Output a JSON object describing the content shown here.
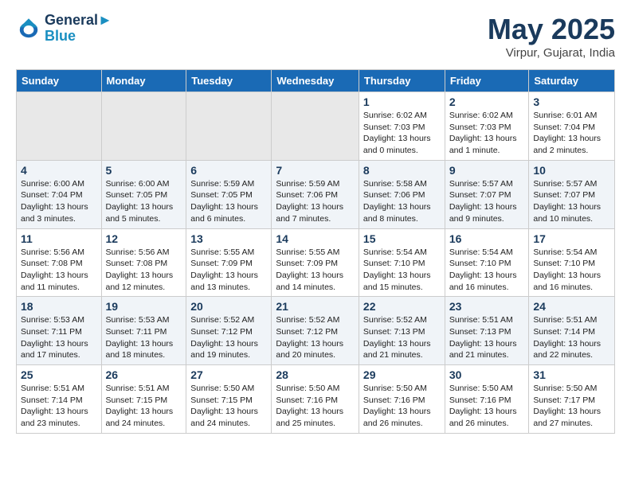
{
  "header": {
    "logo_line1": "General",
    "logo_line2": "Blue",
    "month": "May 2025",
    "location": "Virpur, Gujarat, India"
  },
  "days_of_week": [
    "Sunday",
    "Monday",
    "Tuesday",
    "Wednesday",
    "Thursday",
    "Friday",
    "Saturday"
  ],
  "weeks": [
    [
      {
        "day": "",
        "empty": true
      },
      {
        "day": "",
        "empty": true
      },
      {
        "day": "",
        "empty": true
      },
      {
        "day": "",
        "empty": true
      },
      {
        "day": "1",
        "sunrise": "6:02 AM",
        "sunset": "7:03 PM",
        "daylight": "13 hours and 0 minutes."
      },
      {
        "day": "2",
        "sunrise": "6:02 AM",
        "sunset": "7:03 PM",
        "daylight": "13 hours and 1 minute."
      },
      {
        "day": "3",
        "sunrise": "6:01 AM",
        "sunset": "7:04 PM",
        "daylight": "13 hours and 2 minutes."
      }
    ],
    [
      {
        "day": "4",
        "sunrise": "6:00 AM",
        "sunset": "7:04 PM",
        "daylight": "13 hours and 3 minutes."
      },
      {
        "day": "5",
        "sunrise": "6:00 AM",
        "sunset": "7:05 PM",
        "daylight": "13 hours and 5 minutes."
      },
      {
        "day": "6",
        "sunrise": "5:59 AM",
        "sunset": "7:05 PM",
        "daylight": "13 hours and 6 minutes."
      },
      {
        "day": "7",
        "sunrise": "5:59 AM",
        "sunset": "7:06 PM",
        "daylight": "13 hours and 7 minutes."
      },
      {
        "day": "8",
        "sunrise": "5:58 AM",
        "sunset": "7:06 PM",
        "daylight": "13 hours and 8 minutes."
      },
      {
        "day": "9",
        "sunrise": "5:57 AM",
        "sunset": "7:07 PM",
        "daylight": "13 hours and 9 minutes."
      },
      {
        "day": "10",
        "sunrise": "5:57 AM",
        "sunset": "7:07 PM",
        "daylight": "13 hours and 10 minutes."
      }
    ],
    [
      {
        "day": "11",
        "sunrise": "5:56 AM",
        "sunset": "7:08 PM",
        "daylight": "13 hours and 11 minutes."
      },
      {
        "day": "12",
        "sunrise": "5:56 AM",
        "sunset": "7:08 PM",
        "daylight": "13 hours and 12 minutes."
      },
      {
        "day": "13",
        "sunrise": "5:55 AM",
        "sunset": "7:09 PM",
        "daylight": "13 hours and 13 minutes."
      },
      {
        "day": "14",
        "sunrise": "5:55 AM",
        "sunset": "7:09 PM",
        "daylight": "13 hours and 14 minutes."
      },
      {
        "day": "15",
        "sunrise": "5:54 AM",
        "sunset": "7:10 PM",
        "daylight": "13 hours and 15 minutes."
      },
      {
        "day": "16",
        "sunrise": "5:54 AM",
        "sunset": "7:10 PM",
        "daylight": "13 hours and 16 minutes."
      },
      {
        "day": "17",
        "sunrise": "5:54 AM",
        "sunset": "7:10 PM",
        "daylight": "13 hours and 16 minutes."
      }
    ],
    [
      {
        "day": "18",
        "sunrise": "5:53 AM",
        "sunset": "7:11 PM",
        "daylight": "13 hours and 17 minutes."
      },
      {
        "day": "19",
        "sunrise": "5:53 AM",
        "sunset": "7:11 PM",
        "daylight": "13 hours and 18 minutes."
      },
      {
        "day": "20",
        "sunrise": "5:52 AM",
        "sunset": "7:12 PM",
        "daylight": "13 hours and 19 minutes."
      },
      {
        "day": "21",
        "sunrise": "5:52 AM",
        "sunset": "7:12 PM",
        "daylight": "13 hours and 20 minutes."
      },
      {
        "day": "22",
        "sunrise": "5:52 AM",
        "sunset": "7:13 PM",
        "daylight": "13 hours and 21 minutes."
      },
      {
        "day": "23",
        "sunrise": "5:51 AM",
        "sunset": "7:13 PM",
        "daylight": "13 hours and 21 minutes."
      },
      {
        "day": "24",
        "sunrise": "5:51 AM",
        "sunset": "7:14 PM",
        "daylight": "13 hours and 22 minutes."
      }
    ],
    [
      {
        "day": "25",
        "sunrise": "5:51 AM",
        "sunset": "7:14 PM",
        "daylight": "13 hours and 23 minutes."
      },
      {
        "day": "26",
        "sunrise": "5:51 AM",
        "sunset": "7:15 PM",
        "daylight": "13 hours and 24 minutes."
      },
      {
        "day": "27",
        "sunrise": "5:50 AM",
        "sunset": "7:15 PM",
        "daylight": "13 hours and 24 minutes."
      },
      {
        "day": "28",
        "sunrise": "5:50 AM",
        "sunset": "7:16 PM",
        "daylight": "13 hours and 25 minutes."
      },
      {
        "day": "29",
        "sunrise": "5:50 AM",
        "sunset": "7:16 PM",
        "daylight": "13 hours and 26 minutes."
      },
      {
        "day": "30",
        "sunrise": "5:50 AM",
        "sunset": "7:16 PM",
        "daylight": "13 hours and 26 minutes."
      },
      {
        "day": "31",
        "sunrise": "5:50 AM",
        "sunset": "7:17 PM",
        "daylight": "13 hours and 27 minutes."
      }
    ]
  ],
  "labels": {
    "sunrise": "Sunrise:",
    "sunset": "Sunset:",
    "daylight": "Daylight:"
  }
}
